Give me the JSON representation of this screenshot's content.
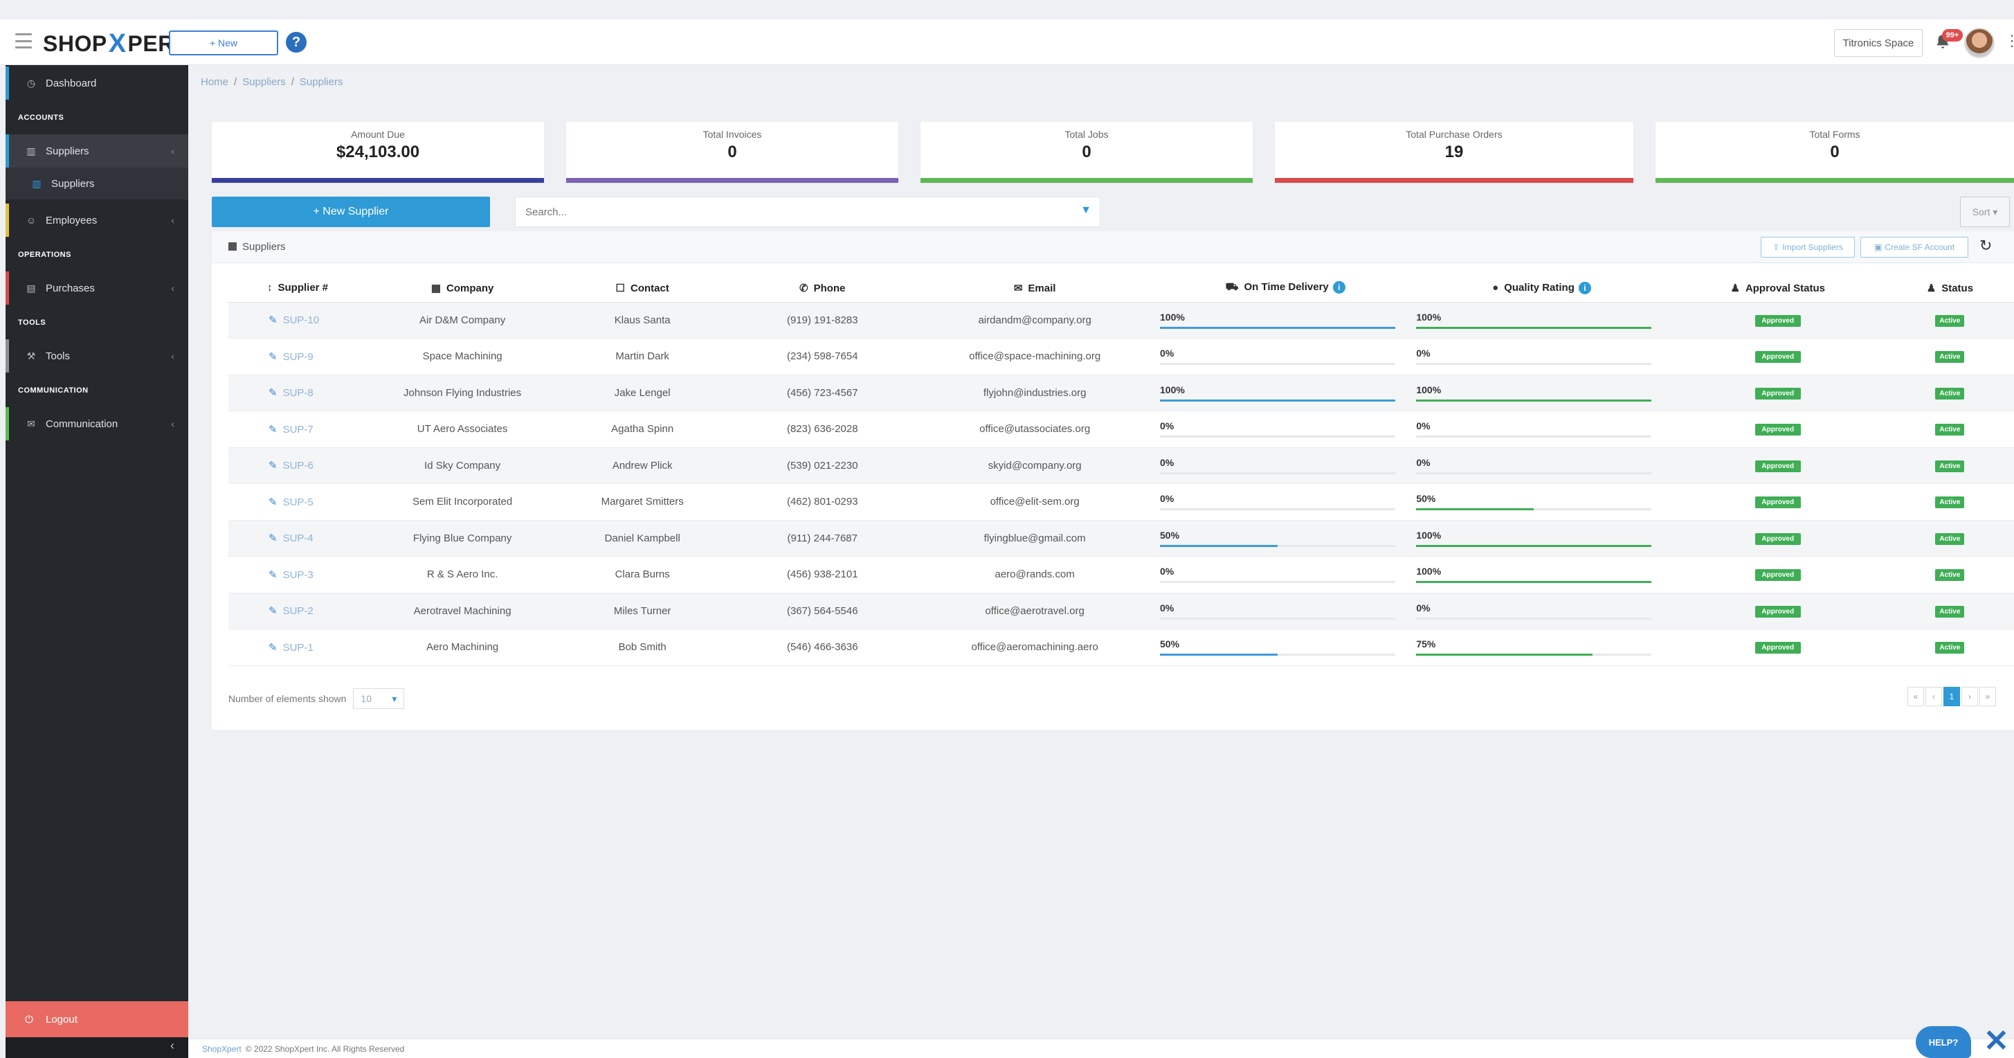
{
  "app": {
    "logo_left": "SHOP",
    "logo_x": "X",
    "logo_right": "PERT",
    "new_button": "+ New",
    "help_icon": "?"
  },
  "header": {
    "company": "Titronics Space",
    "notification_count": "99+"
  },
  "sidebar": {
    "dashboard": "Dashboard",
    "sections": {
      "accounts": "ACCOUNTS",
      "operations": "OPERATIONS",
      "tools": "TOOLS",
      "communication": "COMMUNICATION"
    },
    "suppliers": "Suppliers",
    "suppliers_sub": "Suppliers",
    "employees": "Employees",
    "purchases": "Purchases",
    "tools": "Tools",
    "communication": "Communication",
    "logout": "Logout"
  },
  "breadcrumb": {
    "home": "Home",
    "suppliers": "Suppliers",
    "current": "Suppliers"
  },
  "stats": [
    {
      "label": "Amount Due",
      "value": "$24,103.00",
      "color": "#3b3f9a"
    },
    {
      "label": "Total Invoices",
      "value": "0",
      "color": "#7a62b5"
    },
    {
      "label": "Total Jobs",
      "value": "0",
      "color": "#5fb854"
    },
    {
      "label": "Total Purchase Orders",
      "value": "19",
      "color": "#d94a4a"
    },
    {
      "label": "Total Forms",
      "value": "0",
      "color": "#5fb854"
    }
  ],
  "actions": {
    "new_supplier": "+ New Supplier",
    "search_placeholder": "Search...",
    "sort": "Sort ▾"
  },
  "panel": {
    "title": "Suppliers",
    "import": "Import Suppliers",
    "create_sf": "Create SF Account"
  },
  "table": {
    "headers": [
      "Supplier #",
      "Company",
      "Contact",
      "Phone",
      "Email",
      "On Time Delivery",
      "Quality Rating",
      "Approval Status",
      "Status"
    ],
    "rows": [
      {
        "id": "SUP-10",
        "company": "Air D&M Company",
        "contact": "Klaus Santa",
        "phone": "(919) 191-8283",
        "email": "airdandm@company.org",
        "otd": "100%",
        "otd_v": 100,
        "qr": "100%",
        "qr_v": 100,
        "approval": "Approved",
        "status": "Active"
      },
      {
        "id": "SUP-9",
        "company": "Space Machining",
        "contact": "Martin Dark",
        "phone": "(234) 598-7654",
        "email": "office@space-machining.org",
        "otd": "0%",
        "otd_v": 0,
        "qr": "0%",
        "qr_v": 0,
        "approval": "Approved",
        "status": "Active"
      },
      {
        "id": "SUP-8",
        "company": "Johnson Flying Industries",
        "contact": "Jake Lengel",
        "phone": "(456) 723-4567",
        "email": "flyjohn@industries.org",
        "otd": "100%",
        "otd_v": 100,
        "qr": "100%",
        "qr_v": 100,
        "approval": "Approved",
        "status": "Active"
      },
      {
        "id": "SUP-7",
        "company": "UT Aero Associates",
        "contact": "Agatha Spinn",
        "phone": "(823) 636-2028",
        "email": "office@utassociates.org",
        "otd": "0%",
        "otd_v": 0,
        "qr": "0%",
        "qr_v": 0,
        "approval": "Approved",
        "status": "Active"
      },
      {
        "id": "SUP-6",
        "company": "Id Sky Company",
        "contact": "Andrew Plick",
        "phone": "(539) 021-2230",
        "email": "skyid@company.org",
        "otd": "0%",
        "otd_v": 0,
        "qr": "0%",
        "qr_v": 0,
        "approval": "Approved",
        "status": "Active"
      },
      {
        "id": "SUP-5",
        "company": "Sem Elit Incorporated",
        "contact": "Margaret Smitters",
        "phone": "(462) 801-0293",
        "email": "office@elit-sem.org",
        "otd": "0%",
        "otd_v": 0,
        "qr": "50%",
        "qr_v": 50,
        "approval": "Approved",
        "status": "Active"
      },
      {
        "id": "SUP-4",
        "company": "Flying Blue Company",
        "contact": "Daniel Kampbell",
        "phone": "(911) 244-7687",
        "email": "flyingblue@gmail.com",
        "otd": "50%",
        "otd_v": 50,
        "qr": "100%",
        "qr_v": 100,
        "approval": "Approved",
        "status": "Active"
      },
      {
        "id": "SUP-3",
        "company": "R & S Aero Inc.",
        "contact": "Clara Burns",
        "phone": "(456) 938-2101",
        "email": "aero@rands.com",
        "otd": "0%",
        "otd_v": 0,
        "qr": "100%",
        "qr_v": 100,
        "approval": "Approved",
        "status": "Active"
      },
      {
        "id": "SUP-2",
        "company": "Aerotravel Machining",
        "contact": "Miles Turner",
        "phone": "(367) 564-5546",
        "email": "office@aerotravel.org",
        "otd": "0%",
        "otd_v": 0,
        "qr": "0%",
        "qr_v": 0,
        "approval": "Approved",
        "status": "Active"
      },
      {
        "id": "SUP-1",
        "company": "Aero Machining",
        "contact": "Bob Smith",
        "phone": "(546) 466-3636",
        "email": "office@aeromachining.aero",
        "otd": "50%",
        "otd_v": 50,
        "qr": "75%",
        "qr_v": 75,
        "approval": "Approved",
        "status": "Active"
      }
    ]
  },
  "pagination": {
    "label": "Number of elements shown",
    "page_size": "10",
    "first": "«",
    "prev": "‹",
    "current": "1",
    "next": "›",
    "last": "»"
  },
  "footer": {
    "brand": "ShopXpert",
    "text": "© 2022 ShopXpert Inc. All Rights Reserved"
  },
  "help_bubble": "HELP?",
  "colors": {
    "otd_bar": "#3f9ad8",
    "qr_bar": "#3fae55"
  }
}
